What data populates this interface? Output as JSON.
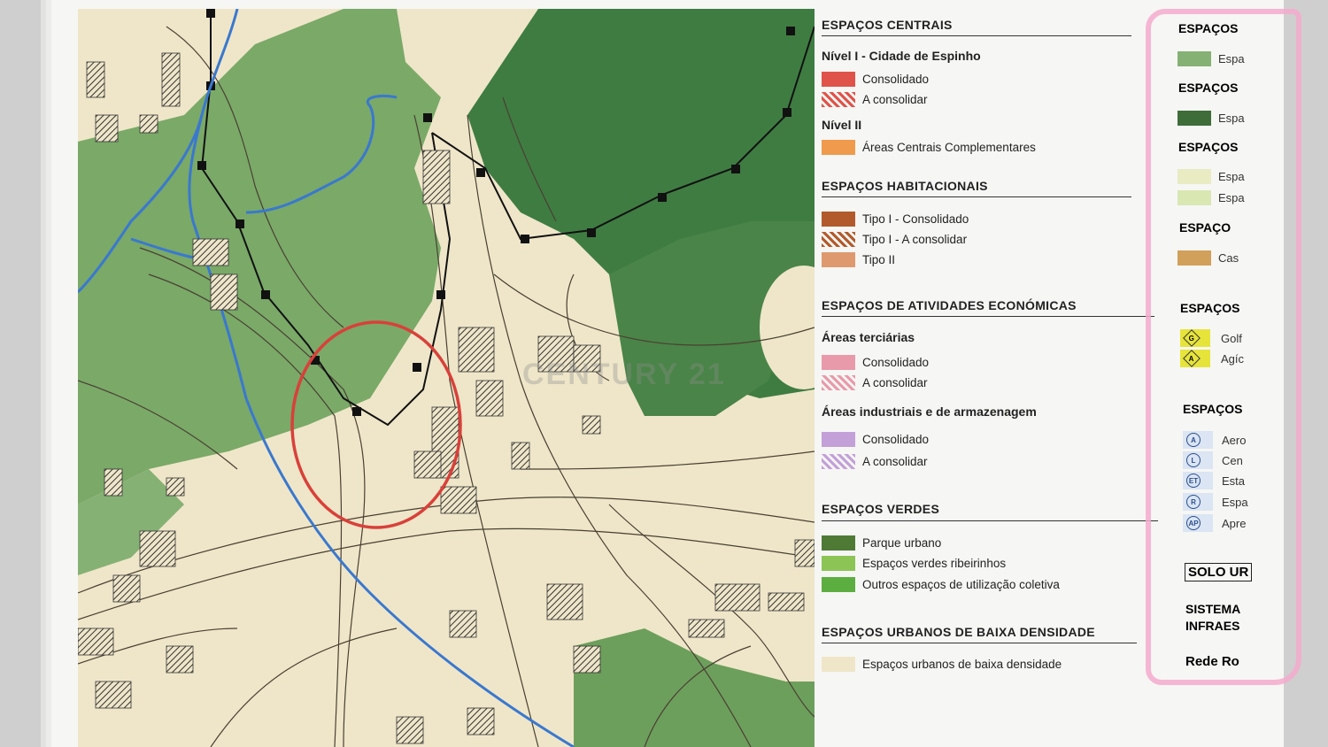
{
  "legend": {
    "centrais": {
      "title": "ESPAÇOS CENTRAIS",
      "nivel1": "Nível I - Cidade de Espinho",
      "consolidado": "Consolidado",
      "a_consolidar": "A consolidar",
      "nivel2": "Nível II",
      "complementares": "Áreas Centrais Complementares"
    },
    "habitacionais": {
      "title": "ESPAÇOS HABITACIONAIS",
      "tipo1c": "Tipo I - Consolidado",
      "tipo1a": "Tipo I - A consolidar",
      "tipo2": "Tipo II"
    },
    "economicas": {
      "title": "ESPAÇOS DE ATIVIDADES ECONÓMICAS",
      "terciarias": "Áreas terciárias",
      "t_consolidado": "Consolidado",
      "t_a_consolidar": "A consolidar",
      "industriais": "Áreas industriais e de armazenagem",
      "i_consolidado": "Consolidado",
      "i_a_consolidar": "A consolidar"
    },
    "verdes": {
      "title": "ESPAÇOS VERDES",
      "parque": "Parque urbano",
      "ribeirinhos": "Espaços verdes ribeirinhos",
      "coletiva": "Outros espaços de utilização coletiva"
    },
    "baixa": {
      "title": "ESPAÇOS URBANOS DE BAIXA DENSIDADE",
      "item": "Espaços urbanos de baixa densidade"
    }
  },
  "right_column": {
    "h1": "ESPAÇOS",
    "i1": "Espa",
    "h2": "ESPAÇOS",
    "i2": "Espa",
    "h3": "ESPAÇOS",
    "i3a": "Espa",
    "i3b": "Espa",
    "h4": "ESPAÇO",
    "i4": "Cas",
    "h5": "ESPAÇOS",
    "i5a": "Golf",
    "i5b": "Agíc",
    "h6": "ESPAÇOS",
    "e1": "Aero",
    "e2": "Cen",
    "e3": "Esta",
    "e4": "Espa",
    "e5": "Apre",
    "icon_letters": [
      "A",
      "L",
      "ET",
      "R",
      "AP"
    ],
    "yellow_letters": [
      "G",
      "A"
    ],
    "solo": "SOLO UR",
    "sistema1": "SISTEMA",
    "sistema2": "INFRAES",
    "rede": "Rede Ro"
  },
  "watermark": "CENTURY 21",
  "colors": {
    "consolidado_red": "#e0534a",
    "areas_complementares": "#ef9a4c",
    "tipo1": "#b35a2c",
    "tipo2": "#de9a6e",
    "terciario": "#e99aaa",
    "industrial": "#c3a0d8",
    "parque": "#4f7a36",
    "ribeirinho": "#8cc556",
    "coletiva": "#5dae40",
    "baixa_densidade": "#efe6c9",
    "map_green_light": "#7aa968",
    "map_green_dark": "#3f7c42",
    "river_blue": "#3a78cf",
    "circle_red": "#d9403a",
    "highlight_pink": "#f4aacc"
  }
}
